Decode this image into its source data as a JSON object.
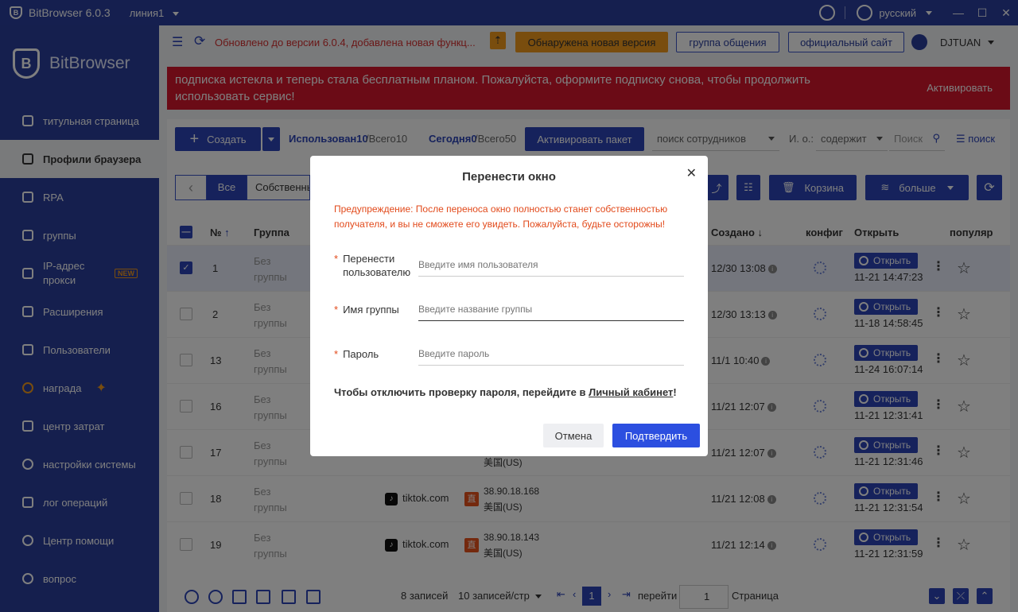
{
  "titlebar": {
    "app": "BitBrowser 6.0.3",
    "line": "линия1",
    "language": "русский"
  },
  "sidebar": {
    "brand": "BitBrowser",
    "items": [
      {
        "label": "титульная страница"
      },
      {
        "label": "Профили браузера"
      },
      {
        "label": "RPA"
      },
      {
        "label": "группы"
      },
      {
        "label": "IP-адрес прокси",
        "badge": "NEW"
      },
      {
        "label": "Расширения"
      },
      {
        "label": "Пользователи"
      },
      {
        "label": "награда"
      },
      {
        "label": "центр затрат"
      },
      {
        "label": "настройки системы"
      },
      {
        "label": "лог операций"
      },
      {
        "label": "Центр помощи"
      },
      {
        "label": "вопрос"
      }
    ]
  },
  "topbar": {
    "notice": "Обновлено до версии 6.0.4, добавлена новая функц...",
    "new_version": "Обнаружена новая версия",
    "group_chat": "группа общения",
    "official_site": "официальный сайт",
    "user": "DJTUAN"
  },
  "banner": {
    "text": "подписка истекла и теперь стала бесплатным планом. Пожалуйста, оформите подписку снова, чтобы продолжить использовать сервис!",
    "activate": "Активировать"
  },
  "toolbar": {
    "create": "Создать",
    "used_label": "Использован10",
    "used_total": "/Всего10",
    "today_label": "Сегодня0",
    "today_total": "/Всего50",
    "activate_package": "Активировать пакет",
    "employee_search": "поиск сотрудников",
    "field": "И. о.:",
    "contains": "содержит",
    "search_placeholder": "Поиск",
    "search": "поиск",
    "tab_all": "Все",
    "tab_own": "Собственные",
    "trash": "Корзина",
    "more": "больше"
  },
  "table": {
    "headers": {
      "no": "№",
      "group": "Группа",
      "created": "Создано",
      "config": "конфиг",
      "open": "Открыть",
      "popular": "популяр"
    },
    "open_label": "Открыть",
    "rows": [
      {
        "no": "1",
        "group": "Без группы",
        "platform": "",
        "ip": "",
        "country": "",
        "created": "12/30 13:08",
        "opened": "11-21 14:47:23",
        "checked": true
      },
      {
        "no": "2",
        "group": "Без группы",
        "platform": "",
        "ip": "",
        "country": "",
        "created": "12/30 13:13",
        "opened": "11-18 14:58:45",
        "checked": false
      },
      {
        "no": "13",
        "group": "Без группы",
        "platform": "",
        "ip": "",
        "country": "",
        "created": "11/1 10:40",
        "opened": "11-24 16:07:14",
        "checked": false
      },
      {
        "no": "16",
        "group": "Без группы",
        "platform": "",
        "ip": "",
        "country": "",
        "created": "11/21 12:07",
        "opened": "11-21 12:31:41",
        "checked": false
      },
      {
        "no": "17",
        "group": "Без группы",
        "platform": "",
        "ip": "",
        "country": "美国(US)",
        "created": "11/21 12:07",
        "opened": "11-21 12:31:46",
        "checked": false
      },
      {
        "no": "18",
        "group": "Без группы",
        "platform": "tiktok.com",
        "ip": "38.90.18.168",
        "country": "美国(US)",
        "created": "11/21 12:08",
        "opened": "11-21 12:31:54",
        "checked": false
      },
      {
        "no": "19",
        "group": "Без группы",
        "platform": "tiktok.com",
        "ip": "38.90.18.143",
        "country": "美国(US)",
        "created": "11/21 12:14",
        "opened": "11-21 12:31:59",
        "checked": false
      }
    ]
  },
  "footer": {
    "records": "8 записей",
    "per_page": "10 записей/стр",
    "page": "1",
    "goto": "перейти",
    "goto_value": "1",
    "page_word": "Страница"
  },
  "modal": {
    "title": "Перенести окно",
    "warning": "Предупреждение: После переноса окно полностью станет собственностью получателя, и вы не сможете его увидеть. Пожалуйста, будьте осторожны!",
    "transfer_label": "Перенести пользователю",
    "transfer_placeholder": "Введите имя пользователя",
    "group_label": "Имя группы",
    "group_placeholder": "Введите название группы",
    "password_label": "Пароль",
    "password_placeholder": "Введите пароль",
    "note_prefix": "Чтобы отключить проверку пароля, перейдите в ",
    "note_link": "Личный кабинет",
    "note_suffix": "!",
    "cancel": "Отмена",
    "confirm": "Подтвердить"
  }
}
